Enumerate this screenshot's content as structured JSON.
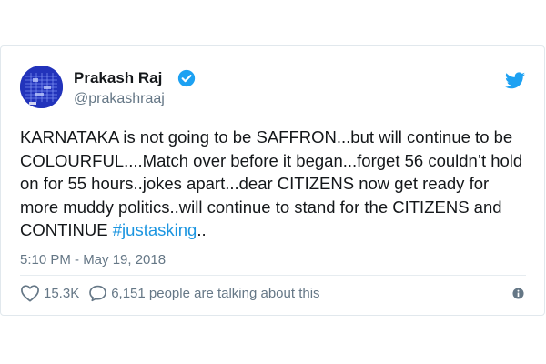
{
  "author": {
    "name": "Prakash Raj",
    "handle": "@prakashraaj",
    "verified": true
  },
  "tweet": {
    "text": "KARNATAKA is not going to be SAFFRON...but will continue to be COLOURFUL....Match over before it began...forget 56 couldn’t hold on for 55 hours..jokes apart...dear CITIZENS  now get ready for more muddy politics..will continue to stand for the CITIZENS and CONTINUE ",
    "hashtag": "#justasking",
    "trailing": "..",
    "timestamp": "5:10 PM - May 19, 2018"
  },
  "actions": {
    "like_count": "15.3K",
    "talking_text": "6,151 people are talking about this"
  },
  "icons": {
    "verified": "verified-badge-icon",
    "brand": "twitter-bird-icon",
    "like": "heart-icon",
    "talk": "speech-bubble-icon",
    "info": "info-icon"
  },
  "colors": {
    "brand": "#1da1f2",
    "link": "#1b95e0",
    "text": "#14171a",
    "muted": "#657786",
    "avatar": "#2233bb"
  }
}
